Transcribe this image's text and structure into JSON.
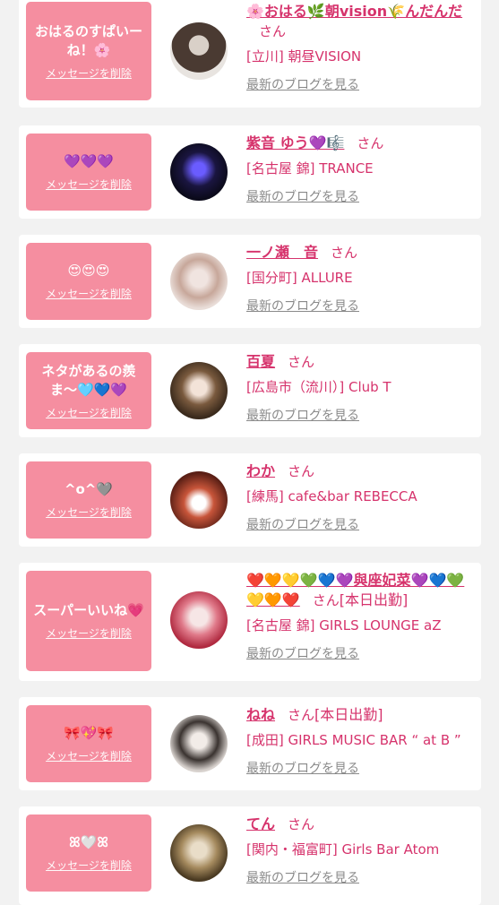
{
  "delete_label": "メッセージを削除",
  "blog_label": "最新のブログを見る",
  "san_label": "さん",
  "cards": [
    {
      "message": "おはるのすぱいーね！🌸",
      "name": "🌸おはる🌿朝vision🌾んだんだ",
      "suffix": "",
      "shop": "[立川] 朝昼VISION"
    },
    {
      "message": "💜💜💜",
      "name": "紫音 ゆう💜🎼",
      "suffix": "",
      "shop": "[名古屋 錦] TRANCE"
    },
    {
      "message": "😍😍😍",
      "name": "一ノ瀬　音",
      "suffix": "",
      "shop": "[国分町] ALLURE"
    },
    {
      "message": "ネタがあるの羨ま〜🩵💙💜",
      "name": "百夏",
      "suffix": "",
      "shop": "[広島市（流川）] Club T"
    },
    {
      "message": "^o^🩶",
      "name": "わか",
      "suffix": "",
      "shop": "[練馬] cafe&bar REBECCA"
    },
    {
      "message": "スーパーいいね💗",
      "name": "❤️🧡💛💚💙💜與座妃菜💜💙💚💛🧡❤️",
      "suffix": "[本日出勤]",
      "shop": "[名古屋 錦] GIRLS LOUNGE aZ"
    },
    {
      "message": "🎀💖🎀",
      "name": "ねね",
      "suffix": "[本日出勤]",
      "shop": "[成田] GIRLS MUSIC BAR “ at B ”"
    },
    {
      "message": "ꕤ🤍ꕤ",
      "name": "てん",
      "suffix": "",
      "shop": "[関内・福富町] Girls Bar Atom"
    }
  ],
  "colors": {
    "accent": "#d6336c",
    "bubble": "#f58ea0",
    "background": "#f2f2f2"
  }
}
